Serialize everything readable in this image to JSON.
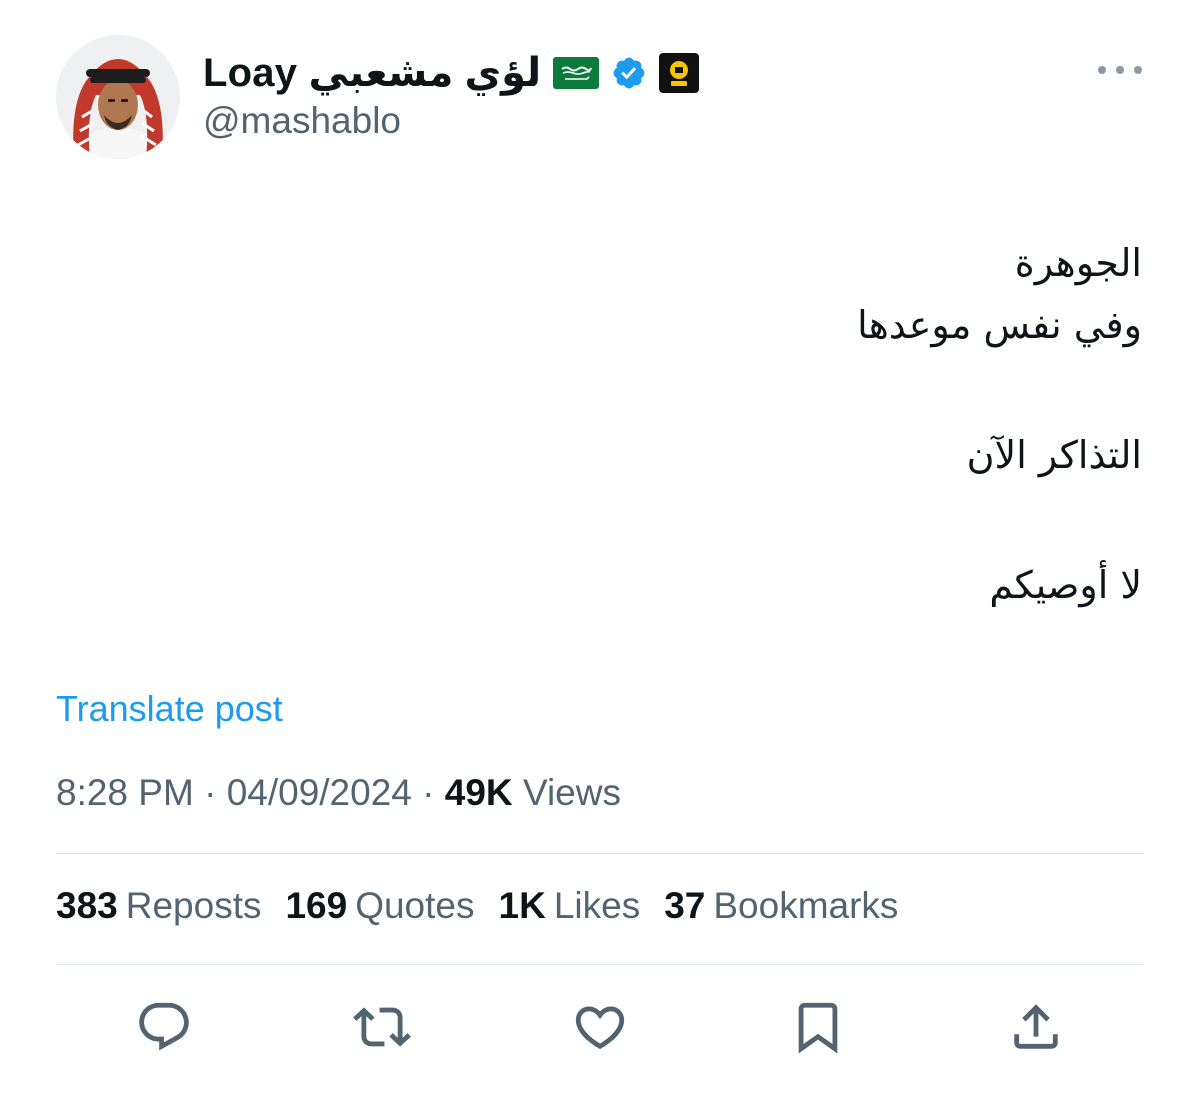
{
  "author": {
    "display_name": "Loay لؤي مشعبي",
    "handle": "@mashablo",
    "badges": [
      "saudi-flag-icon",
      "verified-badge-icon",
      "ittihad-club-logo"
    ]
  },
  "tweet": {
    "lines": [
      "الجوهرة",
      "وفي نفس موعدها",
      "",
      "التذاكر الآن",
      "",
      "لا أوصيكم"
    ]
  },
  "translate_label": "Translate post",
  "meta": {
    "time": "8:28 PM",
    "separator": "·",
    "date": "04/09/2024",
    "views_count": "49K",
    "views_label": "Views"
  },
  "stats": [
    {
      "count": "383",
      "label": "Reposts"
    },
    {
      "count": "169",
      "label": "Quotes"
    },
    {
      "count": "1K",
      "label": "Likes"
    },
    {
      "count": "37",
      "label": "Bookmarks"
    }
  ],
  "actions": [
    "reply-icon",
    "repost-icon",
    "like-icon",
    "bookmark-icon",
    "share-icon"
  ],
  "colors": {
    "text": "#0f1419",
    "secondary": "#536471",
    "link": "#1d9bf0",
    "verified": "#1d9bf0",
    "divider": "#e1e8ed",
    "icons": "#536471"
  }
}
